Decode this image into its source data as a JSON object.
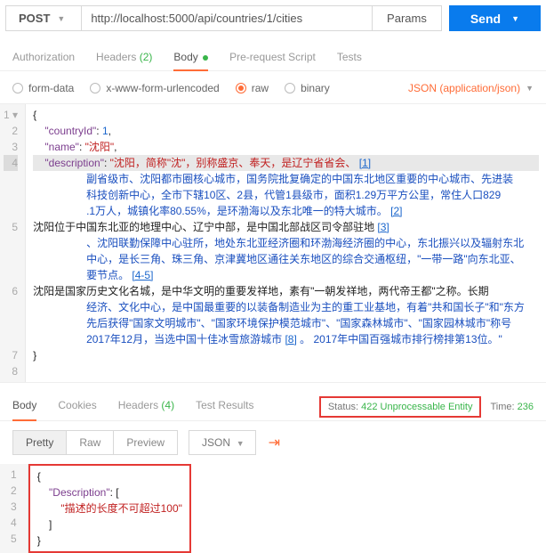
{
  "request": {
    "method": "POST",
    "url": "http://localhost:5000/api/countries/1/cities",
    "params_btn": "Params",
    "send_btn": "Send"
  },
  "req_tabs": {
    "authorization": "Authorization",
    "headers": "Headers",
    "headers_count": "(2)",
    "body": "Body",
    "prescript": "Pre-request Script",
    "tests": "Tests"
  },
  "body_types": {
    "formdata": "form-data",
    "urlencoded": "x-www-form-urlencoded",
    "raw": "raw",
    "binary": "binary",
    "format": "JSON (application/json)"
  },
  "req_body": {
    "lines": [
      "1",
      "2",
      "3",
      "4",
      "5",
      "6",
      "7",
      "8"
    ],
    "l1_fold": "▾",
    "l1": "{",
    "l2_k": "\"countryId\"",
    "l2_v": "1",
    "l3_k": "\"name\"",
    "l3_v": "\"沈阳\"",
    "l4_k": "\"description\"",
    "l4_v": "\"沈阳，简称\"沈\"，别称盛京、奉天，是辽宁省省会、",
    "l4_lnk": "[1]",
    "l4c1": "副省级市、沈阳都市圈核心城市，国务院批复确定的中国东北地区重要的中心城市、先进装",
    "l4c2": "科技创新中心，全市下辖10区、2县，代管1县级市，面积1.29万平方公里，常住人口829",
    "l4c3": ".1万人，城镇化率80.55%，是环渤海以及东北唯一的特大城市。",
    "l4c3_lnk": "[2]",
    "l5": "沈阳位于中国东北亚的地理中心、辽宁中部，是中国北部战区司令部驻地",
    "l5_lnk": "[3]",
    "l5c1": "、沈阳联勤保障中心驻所，地处东北亚经济圈和环渤海经济圈的中心，东北振兴以及辐射东北",
    "l5c2": "中心，是长三角、珠三角、京津冀地区通往关东地区的综合交通枢纽，\"一带一路\"向东北亚、",
    "l5c3": "要节点。",
    "l5c3_lnk": "[4-5]",
    "l6": "沈阳是国家历史文化名城，是中华文明的重要发祥地，素有\"一朝发祥地，两代帝王都\"之称。长期",
    "l6c1": "经济、文化中心，是中国最重要的以装备制造业为主的重工业基地，有着\"共和国长子\"和\"东方",
    "l6c2": "先后获得\"国家文明城市\"、\"国家环境保护模范城市\"、\"国家森林城市\"、\"国家园林城市\"称号",
    "l6c3_a": "2017年12月，当选中国十佳冰雪旅游城市",
    "l6c3_lnk": "[8]",
    "l6c3_b": "。  2017年中国百强城市排行榜排第13位。\"",
    "l7": "}"
  },
  "resp_tabs": {
    "body": "Body",
    "cookies": "Cookies",
    "headers": "Headers",
    "headers_count": "(4)",
    "tests": "Test Results"
  },
  "status": {
    "label": "Status:",
    "value": "422 Unprocessable Entity",
    "time_label": "Time:",
    "time_value": "236"
  },
  "view_opts": {
    "pretty": "Pretty",
    "raw": "Raw",
    "preview": "Preview",
    "fmt": "JSON"
  },
  "resp_body": {
    "lines": [
      "1",
      "2",
      "3",
      "4",
      "5"
    ],
    "l1": "{",
    "l2_k": "\"Description\"",
    "l3": "\"描述的长度不可超过100\"",
    "l4": "]",
    "l5": "}"
  }
}
